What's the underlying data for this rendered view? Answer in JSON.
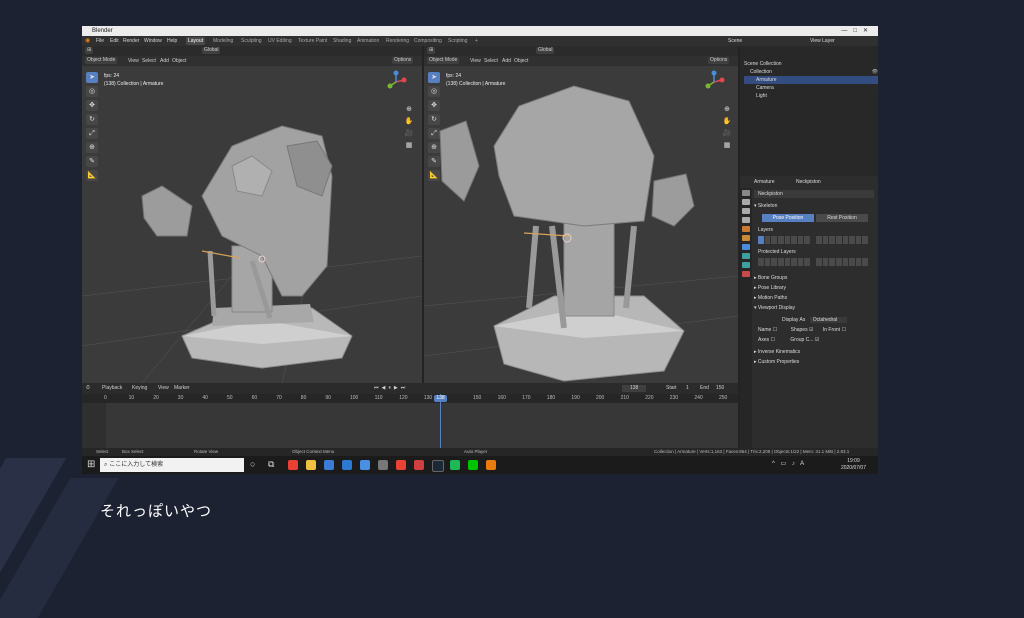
{
  "caption": "それっぽいやつ",
  "window": {
    "title": "Blender"
  },
  "menu": [
    "File",
    "Edit",
    "Render",
    "Window",
    "Help"
  ],
  "workspaces": [
    "Layout",
    "Modeling",
    "Sculpting",
    "UV Editing",
    "Texture Paint",
    "Shading",
    "Animation",
    "Rendering",
    "Compositing",
    "Scripting"
  ],
  "active_workspace": "Layout",
  "scene": {
    "label": "Scene",
    "view_layer": "View Layer"
  },
  "viewport": {
    "mode": "Object Mode",
    "menus": [
      "View",
      "Select",
      "Add",
      "Object"
    ],
    "orientation": "Global",
    "options": "Options",
    "info_fps": "fps: 24",
    "info_collection": "(138) Collection | Armature"
  },
  "outliner": {
    "rows": [
      {
        "label": "Scene Collection",
        "indent": 0
      },
      {
        "label": "Collection",
        "indent": 1
      },
      {
        "label": "Armature",
        "indent": 2
      },
      {
        "label": "Camera",
        "indent": 2
      },
      {
        "label": "Light",
        "indent": 2
      }
    ]
  },
  "properties": {
    "object_tab": "Armature",
    "data_tab": "Neckpiston",
    "data_name": "Neckpiston",
    "skeleton": "Skeleton",
    "pose_position": "Pose Position",
    "rest_position": "Rest Position",
    "layers": "Layers",
    "protected_layers": "Protected Layers",
    "sections": [
      "Bone Groups",
      "Pose Library",
      "Motion Paths",
      "Viewport Display"
    ],
    "display_as_label": "Display As",
    "display_as_value": "Octahedral",
    "name_label": "Name",
    "shapes_label": "Shapes",
    "in_front_label": "In Front",
    "axes_label": "Axes",
    "group_colors_label": "Group C...",
    "tail_sections": [
      "Inverse Kinematics",
      "Custom Properties"
    ]
  },
  "timeline": {
    "menus": [
      "Playback",
      "Keying",
      "View",
      "Marker"
    ],
    "current_frame": "138",
    "start_label": "Start",
    "start": "1",
    "end_label": "End",
    "end": "150",
    "ruler": [
      "0",
      "10",
      "20",
      "30",
      "40",
      "50",
      "60",
      "70",
      "80",
      "90",
      "100",
      "110",
      "120",
      "130",
      "150",
      "160",
      "170",
      "180",
      "190",
      "200",
      "210",
      "220",
      "230",
      "240",
      "250"
    ]
  },
  "status": {
    "select": "Select",
    "box_select": "Box Select",
    "rotate": "Rotate View",
    "context": "Object Context Menu",
    "auto_keying": "Auto Player",
    "stats": "Collection | Armature | Verts:1,163 | Faces:864 | Tris:2,208 | Objects:1/22 | Mem: 31.1 MiB | 2.83.1"
  },
  "taskbar": {
    "search_placeholder": "ここに入力して検索",
    "time": "19:09",
    "date": "2020/07/07"
  }
}
